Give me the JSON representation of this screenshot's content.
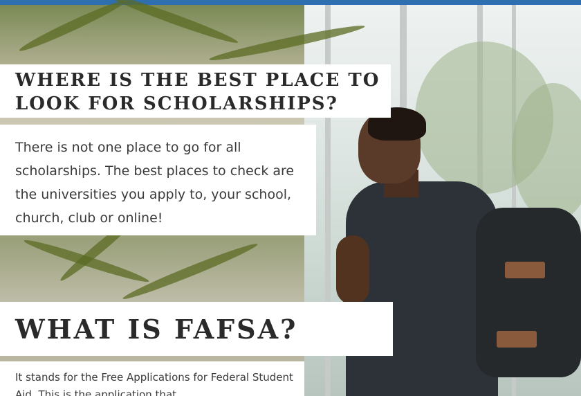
{
  "sections": [
    {
      "heading": "WHERE IS THE BEST PLACE TO LOOK FOR SCHOLARSHIPS?",
      "text": "There is not one place to go for all scholarships. The best places to check are the universities you apply to, your school, church, club or online!"
    },
    {
      "heading": "WHAT IS FAFSA?",
      "text": "It stands for the Free Applications for Federal Student Aid. This is the application that"
    }
  ],
  "colors": {
    "accent_bar": "#2f6fb0",
    "card_background": "#ffffff",
    "heading_text": "#2a2a2a",
    "body_text": "#3a3a3a"
  }
}
